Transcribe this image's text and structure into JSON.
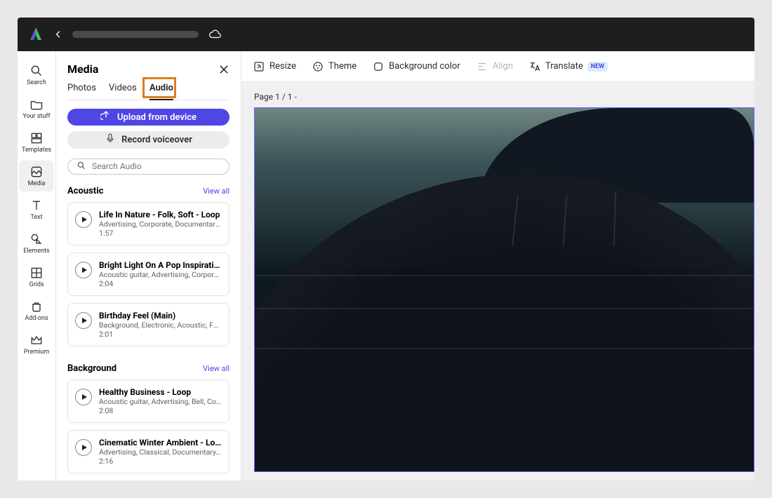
{
  "rail": {
    "items": [
      {
        "label": "Search"
      },
      {
        "label": "Your stuff"
      },
      {
        "label": "Templates"
      },
      {
        "label": "Media"
      },
      {
        "label": "Text"
      },
      {
        "label": "Elements"
      },
      {
        "label": "Grids"
      },
      {
        "label": "Add-ons"
      },
      {
        "label": "Premium"
      }
    ]
  },
  "panel": {
    "title": "Media",
    "tabs": {
      "photos": "Photos",
      "videos": "Videos",
      "audio": "Audio"
    },
    "upload_label": "Upload from device",
    "record_label": "Record voiceover",
    "search_placeholder": "Search Audio",
    "view_all": "View all",
    "sections": [
      {
        "title": "Acoustic",
        "tracks": [
          {
            "title": "Life In Nature - Folk, Soft - Loop",
            "meta": "Advertising, Corporate, Documentary, D…",
            "dur": "1:57"
          },
          {
            "title": "Bright Light On A Pop Inspiratio…",
            "meta": "Acoustic guitar, Advertising, Corporate, …",
            "dur": "2:04"
          },
          {
            "title": "Birthday Feel (Main)",
            "meta": "Background, Electronic, Acoustic, Folk, …",
            "dur": "2:01"
          }
        ]
      },
      {
        "title": "Background",
        "tracks": [
          {
            "title": "Healthy Business - Loop",
            "meta": "Acoustic guitar, Advertising, Bell, Corpor…",
            "dur": "2:08"
          },
          {
            "title": "Cinematic Winter Ambient - Loop",
            "meta": "Advertising, Classical, Documentary, Dr…",
            "dur": "2:16"
          }
        ]
      }
    ]
  },
  "toolbar": {
    "resize": "Resize",
    "theme": "Theme",
    "background": "Background color",
    "align": "Align",
    "translate": "Translate",
    "new_badge": "NEW"
  },
  "canvas": {
    "page_label": "Page 1 / 1 -"
  }
}
